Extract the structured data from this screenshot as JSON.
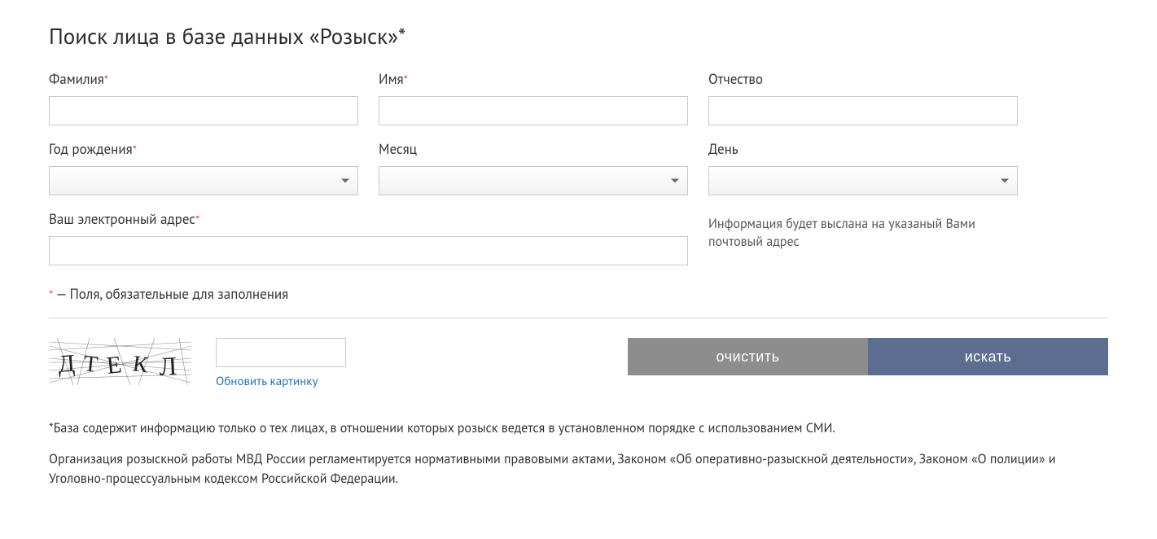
{
  "title": "Поиск лица в базе данных «Розыск»*",
  "fields": {
    "lastname": {
      "label": "Фамилия",
      "required": true
    },
    "firstname": {
      "label": "Имя",
      "required": true
    },
    "patronymic": {
      "label": "Отчество",
      "required": false
    },
    "year": {
      "label": "Год рождения",
      "required": true
    },
    "month": {
      "label": "Месяц",
      "required": false
    },
    "day": {
      "label": "День",
      "required": false
    },
    "email": {
      "label": "Ваш электронный адрес",
      "required": true
    }
  },
  "emailInfo": "Информация будет выслана на указаный Вами почтовый адрес",
  "requiredMark": "*",
  "requiredNote": " — Поля, обязательные для заполнения",
  "captcha": {
    "refresh": "Обновить картинку",
    "text": "ДТЕКЛ"
  },
  "buttons": {
    "clear": "очистить",
    "search": "искать"
  },
  "footnotes": [
    "*База содержит информацию только о тех лицах, в отношении которых розыск ведется в установленном порядке с использованием СМИ.",
    "Организация розыскной работы МВД России регламентируется нормативными правовыми актами, Законом «Об оперативно-разыскной деятельности», Законом «О полиции» и Уголовно-процессуальным кодексом Российской Федерации."
  ]
}
